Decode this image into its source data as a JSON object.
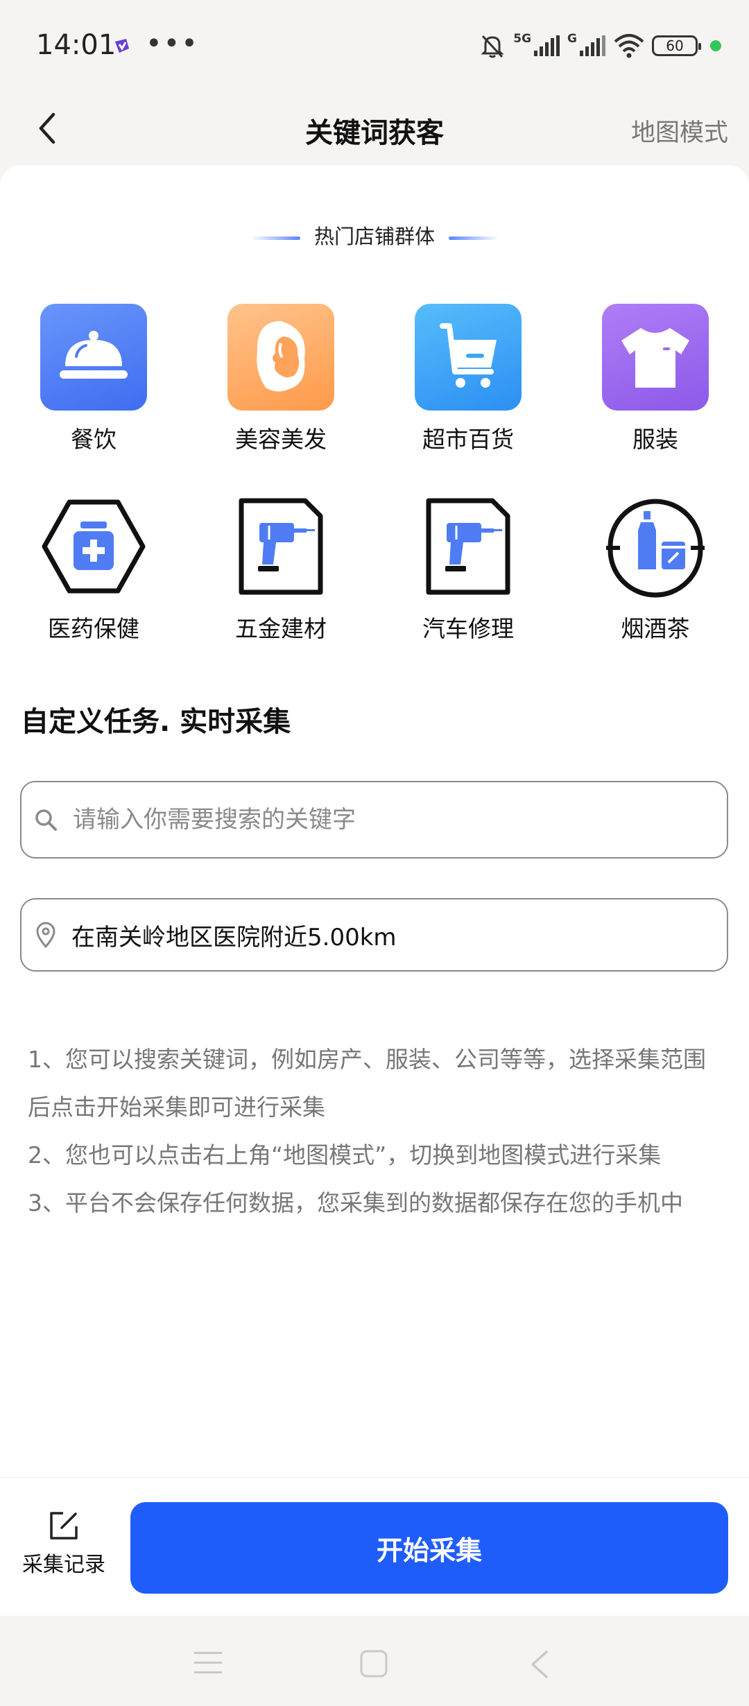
{
  "status": {
    "time": "14:01",
    "net1": "5G",
    "net2": "G",
    "battery": "60"
  },
  "nav": {
    "title": "关键词获客",
    "right_label": "地图模式"
  },
  "hot": {
    "title": "热门店铺群体",
    "categories": [
      {
        "label": "餐饮",
        "icon": "food-cover-icon"
      },
      {
        "label": "美容美发",
        "icon": "beauty-face-icon"
      },
      {
        "label": "超市百货",
        "icon": "shopping-cart-icon"
      },
      {
        "label": "服装",
        "icon": "tshirt-icon"
      },
      {
        "label": "医药保健",
        "icon": "medicine-bottle-icon"
      },
      {
        "label": "五金建材",
        "icon": "drill-tool-icon"
      },
      {
        "label": "汽车修理",
        "icon": "drill-tool-icon"
      },
      {
        "label": "烟酒茶",
        "icon": "bottle-cup-icon"
      }
    ]
  },
  "custom": {
    "title": "自定义任务. 实时采集",
    "search_placeholder": "请输入你需要搜索的关键字",
    "location_text": "在南关岭地区医院附近5.00km"
  },
  "tips": [
    "1、您可以搜索关键词，例如房产、服装、公司等等，选择采集范围后点击开始采集即可进行采集",
    " 2、您也可以点击右上角“地图模式”，切换到地图模式进行采集",
    " 3、平台不会保存任何数据，您采集到的数据都保存在您的手机中"
  ],
  "bottom": {
    "record_label": "采集记录",
    "start_label": "开始采集"
  },
  "colors": {
    "accent": "#1f5dfb",
    "icon_blue": "#4f7cf3",
    "icon_orange": "#ffa35b",
    "icon_sky": "#3aa8f5",
    "icon_purple": "#9a68ee"
  }
}
